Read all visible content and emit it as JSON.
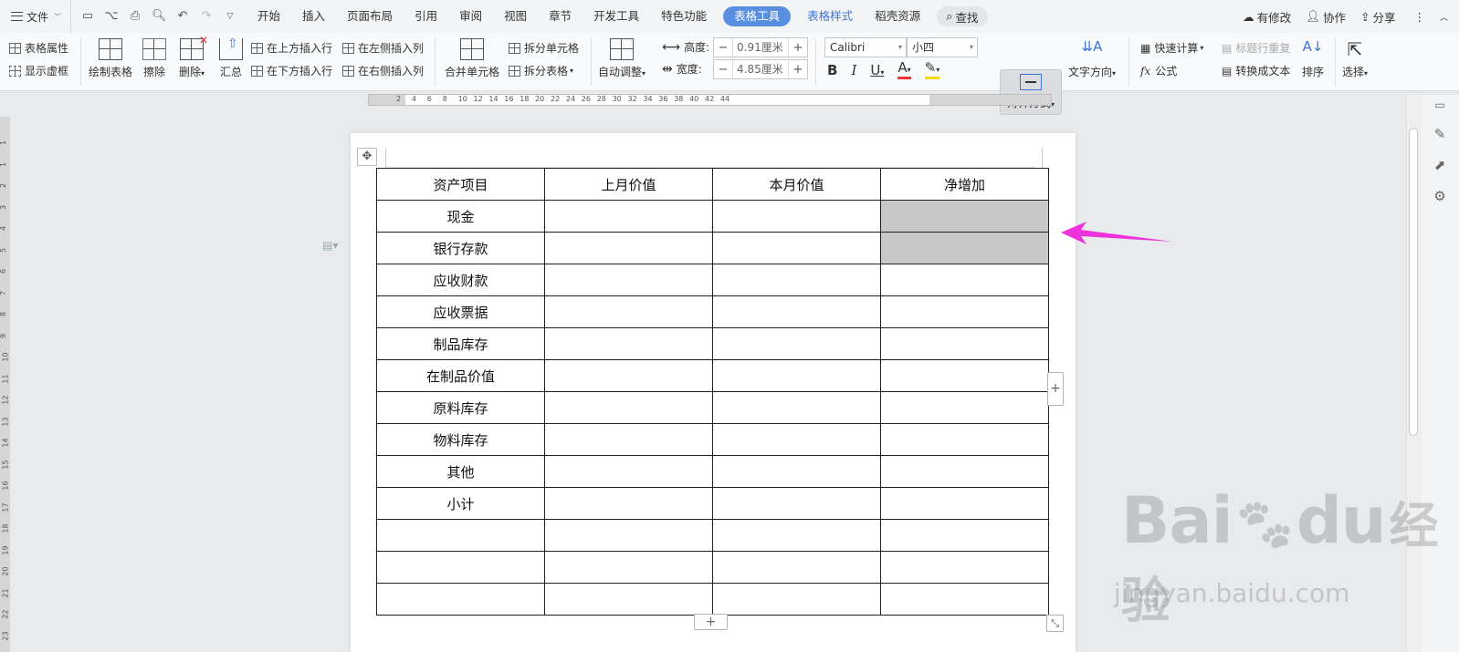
{
  "menubar": {
    "file": "文件",
    "tabs": [
      "开始",
      "插入",
      "页面布局",
      "引用",
      "审阅",
      "视图",
      "章节",
      "开发工具",
      "特色功能"
    ],
    "active_tab": "表格工具",
    "secondary_tab": "表格样式",
    "extra_tab": "稻壳资源",
    "search": "查找",
    "right": {
      "changes": "有修改",
      "collab": "协作",
      "share": "分享"
    }
  },
  "ribbon": {
    "table_props": "表格属性",
    "show_gridlines": "显示虚框",
    "draw_table": "绘制表格",
    "erase": "擦除",
    "delete": "删除",
    "summary": "汇总",
    "insert_above": "在上方插入行",
    "insert_below": "在下方插入行",
    "insert_left": "在左侧插入列",
    "insert_right": "在右侧插入列",
    "merge_cells": "合并单元格",
    "split_cells": "拆分单元格",
    "split_table": "拆分表格",
    "auto_fit": "自动调整",
    "height_label": "高度:",
    "height_value": "0.91厘米",
    "width_label": "宽度:",
    "width_value": "4.85厘米",
    "font_name": "Calibri",
    "font_size": "小四",
    "align": "对齐方式",
    "text_direction": "文字方向",
    "quick_calc": "快速计算",
    "repeat_header": "标题行重复",
    "formula": "公式",
    "to_text": "转换成文本",
    "sort": "排序",
    "select": "选择"
  },
  "ruler": {
    "h_ticks": [
      "2",
      "4",
      "6",
      "8",
      "10",
      "12",
      "14",
      "16",
      "18",
      "20",
      "22",
      "24",
      "26",
      "28",
      "30",
      "32",
      "34",
      "36",
      "38",
      "40",
      "42",
      "44"
    ],
    "v_ticks": [
      "1",
      "1",
      "2",
      "3",
      "4",
      "5",
      "6",
      "7",
      "8",
      "9",
      "10",
      "11",
      "12",
      "13",
      "14",
      "15",
      "16",
      "17",
      "18",
      "19",
      "20",
      "21",
      "22",
      "23"
    ]
  },
  "table": {
    "headers": [
      "资产项目",
      "上月价值",
      "本月价值",
      "净增加"
    ],
    "rows": [
      [
        "现金",
        "",
        "",
        ""
      ],
      [
        "银行存款",
        "",
        "",
        ""
      ],
      [
        "应收财款",
        "",
        "",
        ""
      ],
      [
        "应收票据",
        "",
        "",
        ""
      ],
      [
        "制品库存",
        "",
        "",
        ""
      ],
      [
        "在制品价值",
        "",
        "",
        ""
      ],
      [
        "原料库存",
        "",
        "",
        ""
      ],
      [
        "物料库存",
        "",
        "",
        ""
      ],
      [
        "其他",
        "",
        "",
        ""
      ],
      [
        "小计",
        "",
        "",
        ""
      ],
      [
        "",
        "",
        "",
        ""
      ],
      [
        "",
        "",
        "",
        ""
      ],
      [
        "",
        "",
        "",
        ""
      ]
    ]
  },
  "colors": {
    "accent": "#5a8ee0",
    "arrow": "#ee33dd",
    "selected_cell": "#c8c8c8"
  },
  "watermark": {
    "brand": "Bai",
    "brand2": "du",
    "cn": "经验",
    "site": "jingyan.baidu.com"
  }
}
